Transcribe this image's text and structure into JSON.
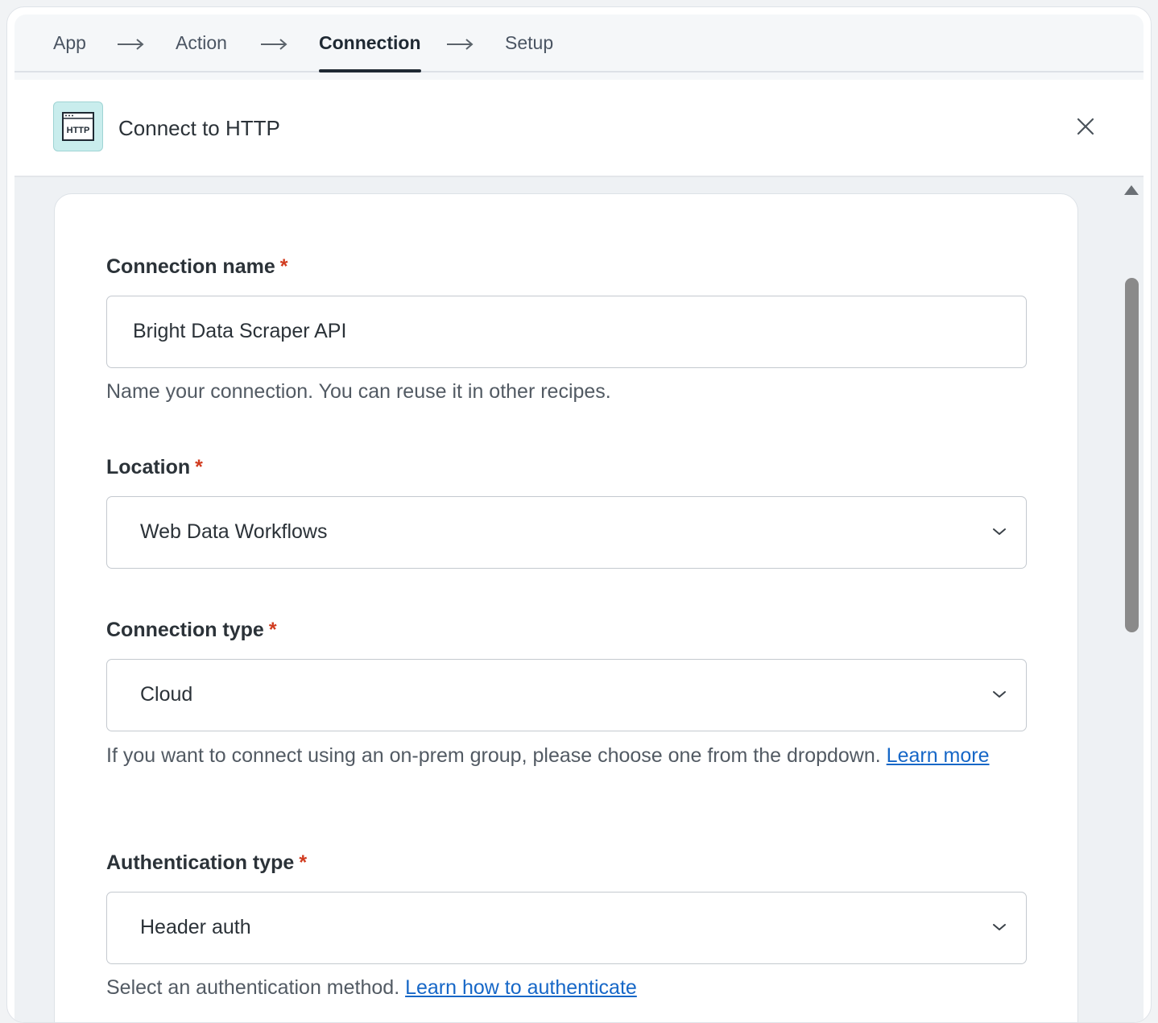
{
  "stepper": {
    "steps": [
      {
        "label": "App"
      },
      {
        "label": "Action"
      },
      {
        "label": "Connection"
      },
      {
        "label": "Setup"
      }
    ]
  },
  "header": {
    "icon_text": "HTTP",
    "title": "Connect to HTTP"
  },
  "form": {
    "connection_name": {
      "label": "Connection name",
      "required_mark": "*",
      "value": "Bright Data Scraper API",
      "hint": "Name your connection. You can reuse it in other recipes."
    },
    "location": {
      "label": "Location",
      "required_mark": "*",
      "value": "Web Data Workflows"
    },
    "connection_type": {
      "label": "Connection type",
      "required_mark": "*",
      "value": "Cloud",
      "hint": "If you want to connect using an on-prem group, please choose one from the dropdown.",
      "hint_link": "Learn more"
    },
    "authentication_type": {
      "label": "Authentication type",
      "required_mark": "*",
      "value": "Header auth",
      "hint": "Select an authentication method.",
      "hint_link": "Learn how to authenticate"
    }
  },
  "colors": {
    "accent_link": "#1667c7",
    "required": "#d13b1f",
    "icon_bg": "#c9eded"
  }
}
